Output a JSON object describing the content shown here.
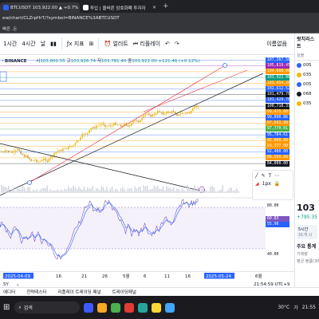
{
  "browser": {
    "tabs": [
      {
        "title": "BTCUSDT 103,922.00 ▲ +0.7%",
        "active": true
      },
      {
        "title": "투입 | 올바른 암호화폐 투자자",
        "active": false
      }
    ],
    "address": "ew/chart/CLZrpHrT/?symbol=BINANCE%3ABTCUSDT",
    "bookmarks_label": "빠른 .돈"
  },
  "toolbar": {
    "interval": "1시간",
    "interval2": "4시간",
    "range_label": "날",
    "indicators": "지표",
    "alert": "얼러트",
    "replay": "리플레이",
    "watchlist_label": "이름없음"
  },
  "symbol_header": {
    "exchange": "· BINANCE",
    "o_label": "시",
    "o": "103,800.55",
    "h_label": "고",
    "h": "103,926.74",
    "l_label": "저",
    "l": "103,781.40",
    "c_label": "종",
    "c": "103,922.00",
    "change": "+121.46 (+0.12%)"
  },
  "price_axis_labels": [
    {
      "text": "107,367.56",
      "color": "#2962ff"
    },
    {
      "text": "105,819.45",
      "color": "#9c27b0"
    },
    {
      "text": "104,088.00",
      "color": "#ff9800"
    },
    {
      "text": "103,922.00",
      "color": "#089981"
    },
    {
      "text": "103,454.29",
      "color": "#ff9800"
    },
    {
      "text": "102,612.52",
      "color": "#2962ff"
    },
    {
      "text": "101,479.70",
      "color": "#131722"
    },
    {
      "text": "101,429.70",
      "color": "#2962ff"
    },
    {
      "text": "100,718.37",
      "color": "#131722"
    },
    {
      "text": "99,475.00",
      "color": "#ff9800"
    },
    {
      "text": "99,090.86",
      "color": "#2962ff"
    },
    {
      "text": "97,693.88",
      "color": "#ff9800"
    },
    {
      "text": "97,770.01",
      "color": "#4caf50"
    },
    {
      "text": "95,784.61",
      "color": "#2962ff"
    },
    {
      "text": "95,000.00",
      "color": "#ff9800"
    },
    {
      "text": "93,377.00",
      "color": "#ff9800"
    },
    {
      "text": "92,400.00",
      "color": "#2962ff"
    },
    {
      "text": "88,500.00",
      "color": "#ff9800"
    },
    {
      "text": "84,000.00",
      "color": "#131722"
    }
  ],
  "osc_axis_labels": [
    {
      "text": "60.83",
      "color": "#7e57c2"
    },
    {
      "text": "55.90",
      "color": "#2962ff"
    },
    {
      "text": "80.00",
      "color": "#131722"
    },
    {
      "text": "40.00",
      "color": "#131722"
    }
  ],
  "time_axis": {
    "start_label": "2025-04-09",
    "ticks": [
      "16",
      "21",
      "26",
      "5월",
      "6",
      "11",
      "16"
    ],
    "end_label": "2025-05-24",
    "last_tick": "6월"
  },
  "bottom": {
    "range": "5Y",
    "clock": "21:54:59 UTC+9"
  },
  "panel_tabs": [
    "에디터",
    "전략테스터",
    "리플레이 트레이딩 패널",
    "트레이딩패널"
  ],
  "right_panel": {
    "title": "왓치리스트",
    "symbol_heading": "심볼",
    "rows": [
      "005",
      "035",
      "005",
      "068",
      "035"
    ],
    "price": "103",
    "change": "+795.35",
    "section": "주요 통계",
    "volume": "거래량",
    "avg": "평균 볼륨(30)",
    "interval_tag": "5시간",
    "session": "31개 시",
    "interval_badge": "1px"
  },
  "taskbar": {
    "search_placeholder": "검색",
    "temp": "30°C",
    "lang": "가",
    "time": "21:55"
  },
  "colors": {
    "up_candle": "#f0b90b",
    "down_candle": "#e8b93f",
    "accent": "#2962ff",
    "osc_band": "#ede7f6"
  }
}
